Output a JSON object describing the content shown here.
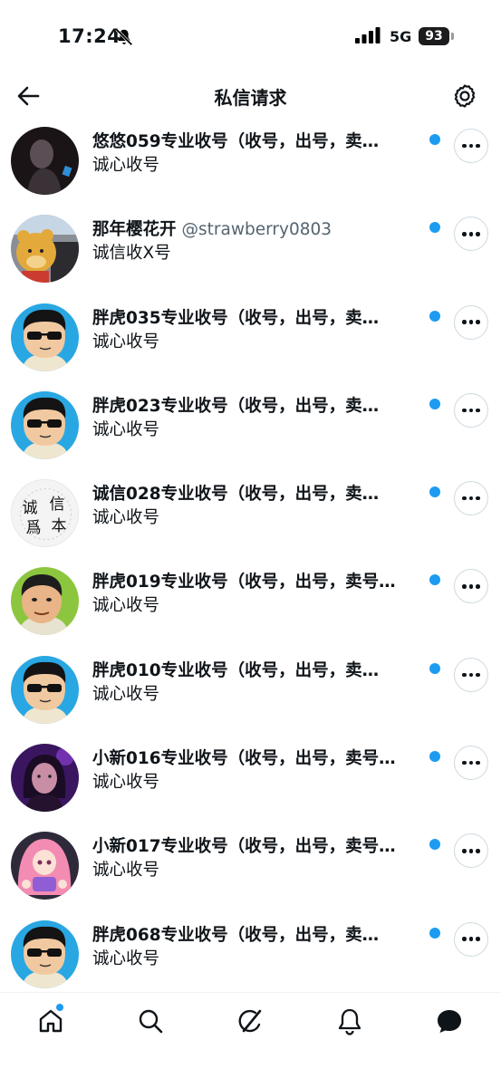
{
  "status_bar": {
    "time": "17:24",
    "network": "5G",
    "battery": "93"
  },
  "header": {
    "title": "私信请求"
  },
  "requests": [
    {
      "name": "悠悠059专业收号（收号，出号，卖…",
      "handle": "",
      "preview": "诚心收号",
      "avatar": "dark-photo"
    },
    {
      "name": "那年樱花开",
      "handle": "@strawberry0803",
      "preview": "诚信收X号",
      "avatar": "bear"
    },
    {
      "name": "胖虎035专业收号（收号，出号，卖…",
      "handle": "",
      "preview": "诚心收号",
      "avatar": "cartoon-man"
    },
    {
      "name": "胖虎023专业收号（收号，出号，卖…",
      "handle": "",
      "preview": "诚心收号",
      "avatar": "cartoon-man"
    },
    {
      "name": "诚信028专业收号（收号，出号，卖…",
      "handle": "",
      "preview": "诚心收号",
      "avatar": "seal"
    },
    {
      "name": "胖虎019专业收号（收号，出号，卖号…",
      "handle": "",
      "preview": "诚心收号",
      "avatar": "cartoon-green"
    },
    {
      "name": "胖虎010专业收号（收号，出号，卖…",
      "handle": "",
      "preview": "诚心收号",
      "avatar": "cartoon-man"
    },
    {
      "name": "小新016专业收号（收号，出号，卖号…",
      "handle": "",
      "preview": "诚心收号",
      "avatar": "purple-photo"
    },
    {
      "name": "小新017专业收号（收号，出号，卖号…",
      "handle": "",
      "preview": "诚心收号",
      "avatar": "anime-girl"
    },
    {
      "name": "胖虎068专业收号（收号，出号，卖…",
      "handle": "",
      "preview": "诚心收号",
      "avatar": "cartoon-man"
    }
  ],
  "seal_text": [
    "诚",
    "信",
    "爲",
    "本"
  ],
  "nav": [
    "home-icon",
    "search-icon",
    "grok-icon",
    "notifications-icon",
    "messages-icon"
  ],
  "colors": {
    "accent": "#1d9bf0",
    "text": "#0f1419",
    "muted": "#536471"
  }
}
